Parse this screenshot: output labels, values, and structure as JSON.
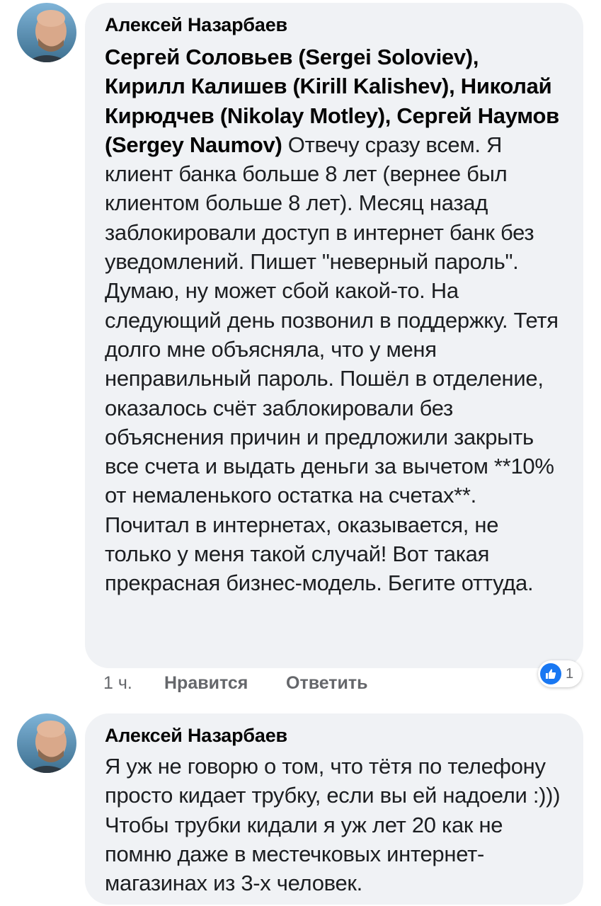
{
  "comments": [
    {
      "author": "Алексей Назарбаев",
      "mentions": [
        "Сергей Соловьев (Sergei Soloviev)",
        "Кирилл Калишев (Kirill Kalishev)",
        "Николай Кирюдчев (Nikolay Motley)",
        "Сергей Наумов (Sergey Naumov)"
      ],
      "separator": ", ",
      "body": " Отвечу сразу всем. Я клиент банка больше 8 лет (вернее был клиентом больше 8 лет). Месяц назад заблокировали доступ в интернет банк без уведомлений. Пишет \"неверный пароль\". Думаю, ну может сбой какой-то. На следующий день позвонил в поддержку. Тетя долго мне объясняла, что у меня неправильный пароль. Пошёл в отделение, оказалось счёт заблокировали без объяснения причин и предложили закрыть все счета и выдать деньги за вычетом **10% от немаленького остатка на счетах**. Почитал в интернетах, оказывается, не только у меня такой случай! Вот такая прекрасная бизнес-модель. Бегите оттуда.",
      "time": "1 ч.",
      "like_label": "Нравится",
      "reply_label": "Ответить",
      "reaction_icon": "thumbs-up-icon",
      "reaction_count": "1",
      "reaction_color": "#1877f2"
    },
    {
      "author": "Алексей Назарбаев",
      "body": "Я уж не говорю о том, что тётя по телефону просто кидает трубку, если вы ей надоели :))) Чтобы трубки кидали я уж лет 20 как не помню даже в местечковых интернет-магазинах из 3-х человек."
    }
  ]
}
